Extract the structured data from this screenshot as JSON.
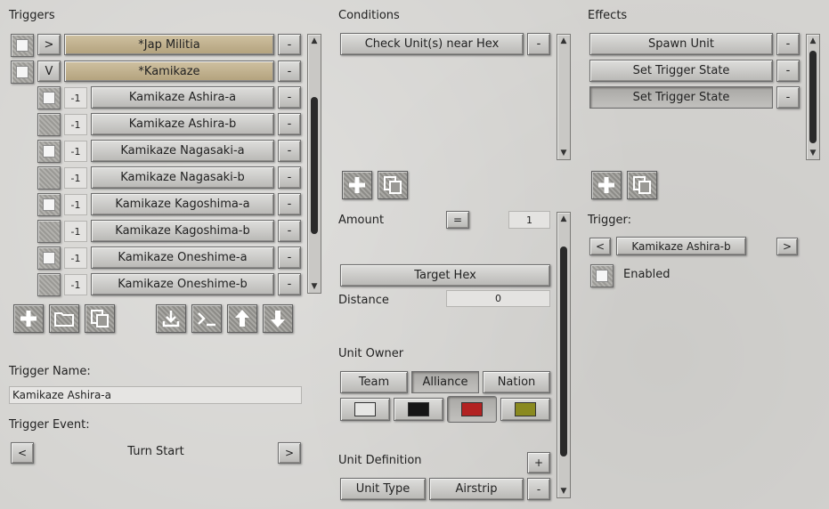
{
  "triggers": {
    "title": "Triggers",
    "groups": [
      {
        "toggle": ">",
        "label": "*Jap Militia",
        "minus": "-"
      },
      {
        "toggle": "V",
        "label": "*Kamikaze",
        "minus": "-"
      }
    ],
    "items": [
      {
        "num": "-1",
        "label": "Kamikaze Ashira-a",
        "checked": true
      },
      {
        "num": "-1",
        "label": "Kamikaze Ashira-b",
        "checked": false
      },
      {
        "num": "-1",
        "label": "Kamikaze Nagasaki-a",
        "checked": true
      },
      {
        "num": "-1",
        "label": "Kamikaze Nagasaki-b",
        "checked": false
      },
      {
        "num": "-1",
        "label": "Kamikaze Kagoshima-a",
        "checked": true
      },
      {
        "num": "-1",
        "label": "Kamikaze Kagoshima-b",
        "checked": false
      },
      {
        "num": "-1",
        "label": "Kamikaze Oneshime-a",
        "checked": true
      },
      {
        "num": "-1",
        "label": "Kamikaze Oneshime-b",
        "checked": false
      }
    ],
    "minus": "-",
    "name_label": "Trigger Name:",
    "name_value": "Kamikaze Ashira-a",
    "event_label": "Trigger Event:",
    "event_value": "Turn Start",
    "prev": "<",
    "next": ">"
  },
  "conditions": {
    "title": "Conditions",
    "items": [
      {
        "label": "Check Unit(s) near Hex",
        "minus": "-"
      }
    ],
    "amount_label": "Amount",
    "amount_op": "=",
    "amount_value": "1",
    "target_hex": "Target Hex",
    "distance_label": "Distance",
    "distance_value": "0",
    "unit_owner_label": "Unit Owner",
    "owner_tabs": [
      "Team",
      "Alliance",
      "Nation"
    ],
    "colors": [
      "#e6e6e4",
      "#151515",
      "#b22222",
      "#8a8a20"
    ],
    "unit_def_label": "Unit Definition",
    "plus": "+",
    "unit_type": "Unit Type",
    "unit_value": "Airstrip",
    "minus": "-"
  },
  "effects": {
    "title": "Effects",
    "items": [
      {
        "label": "Spawn Unit",
        "minus": "-"
      },
      {
        "label": "Set Trigger State",
        "minus": "-"
      },
      {
        "label": "Set Trigger State",
        "minus": "-"
      }
    ],
    "trigger_label": "Trigger:",
    "trigger_value": "Kamikaze Ashira-b",
    "prev": "<",
    "next": ">",
    "enabled_label": "Enabled"
  }
}
